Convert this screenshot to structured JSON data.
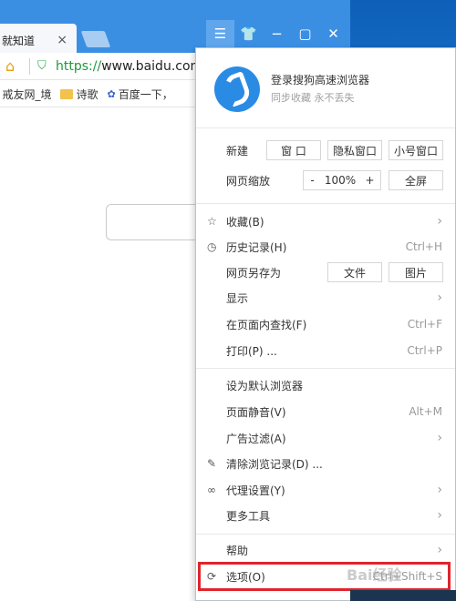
{
  "browser": {
    "tab_title": "就知道",
    "tab_close": "×",
    "url_protocol": "https://",
    "url_rest": "www.baidu.com/",
    "bookmarks": [
      {
        "label": "戒友网_境",
        "icon": "page-icon"
      },
      {
        "label": "诗歌",
        "icon": "folder-icon"
      },
      {
        "label": "百度一下，",
        "icon": "baidu-paw-icon"
      }
    ]
  },
  "window_controls": [
    "menu-icon",
    "skin-icon",
    "minimize-icon",
    "maximize-icon",
    "close-icon"
  ],
  "menu": {
    "profile_title": "登录搜狗高速浏览器",
    "profile_subtitle": "同步收藏 永不丢失",
    "new_label": "新建",
    "new_buttons": [
      "窗 口",
      "隐私窗口",
      "小号窗口"
    ],
    "zoom_label": "网页缩放",
    "zoom_minus": "-",
    "zoom_value": "100%",
    "zoom_plus": "+",
    "fullscreen": "全屏",
    "items": [
      {
        "label": "收藏(B)",
        "icon": "star-icon",
        "shortcut": "",
        "submenu": true
      },
      {
        "label": "历史记录(H)",
        "icon": "clock-icon",
        "shortcut": "Ctrl+H",
        "submenu": false
      },
      {
        "label": "网页另存为",
        "icon": "",
        "shortcut": "",
        "submenu": false
      },
      {
        "label": "显示",
        "icon": "",
        "shortcut": "",
        "submenu": true
      },
      {
        "label": "在页面内查找(F)",
        "icon": "",
        "shortcut": "Ctrl+F",
        "submenu": false
      },
      {
        "label": "打印(P) ...",
        "icon": "",
        "shortcut": "Ctrl+P",
        "submenu": false
      },
      {
        "label": "设为默认浏览器",
        "icon": "",
        "shortcut": "",
        "submenu": false
      },
      {
        "label": "页面静音(V)",
        "icon": "",
        "shortcut": "Alt+M",
        "submenu": false
      },
      {
        "label": "广告过滤(A)",
        "icon": "",
        "shortcut": "",
        "submenu": true
      },
      {
        "label": "清除浏览记录(D) ...",
        "icon": "eraser-icon",
        "shortcut": "",
        "submenu": false
      },
      {
        "label": "代理设置(Y)",
        "icon": "link-icon",
        "shortcut": "",
        "submenu": true
      },
      {
        "label": "更多工具",
        "icon": "",
        "shortcut": "",
        "submenu": true
      },
      {
        "label": "帮助",
        "icon": "",
        "shortcut": "",
        "submenu": true
      },
      {
        "label": "选项(O)",
        "icon": "gear-icon",
        "shortcut": "Ctrl+Shift+S",
        "submenu": false
      }
    ],
    "save_buttons": [
      "文件",
      "图片"
    ]
  },
  "watermark": "Bai经验",
  "highlight_color": "#e0242b",
  "accent_color": "#3b8fe3"
}
